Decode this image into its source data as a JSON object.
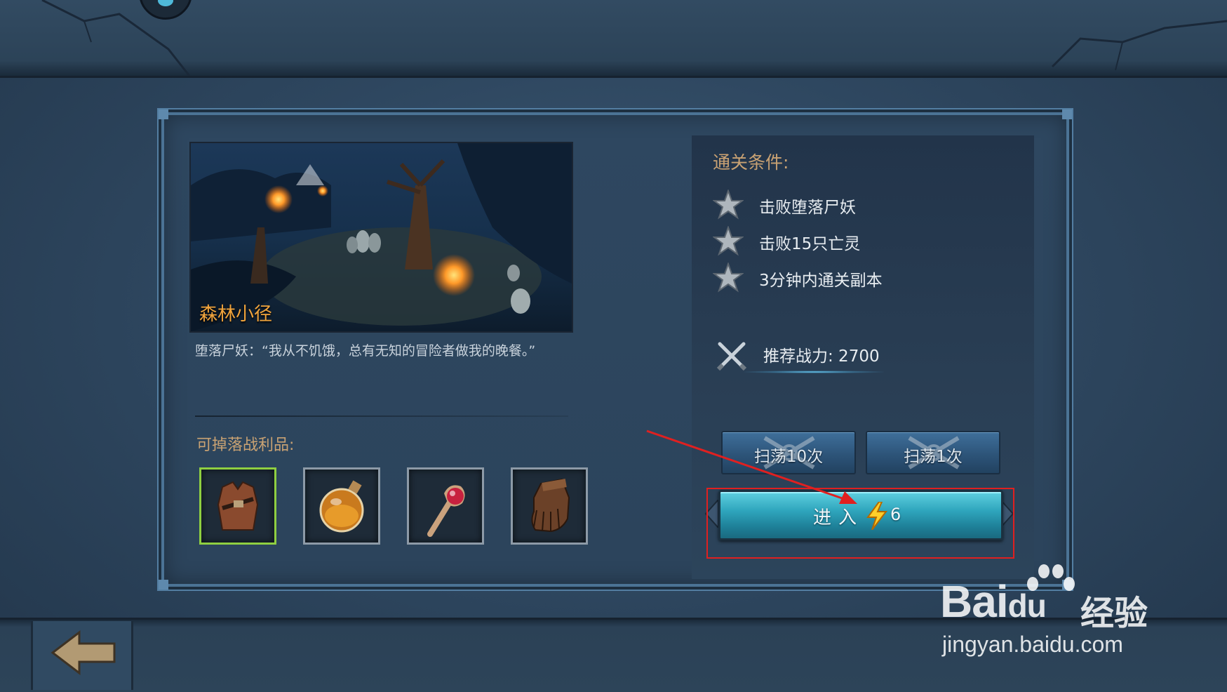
{
  "stage": {
    "name": "森林小径",
    "quote": "堕落尸妖：“我从不饥饿，总有无知的冒险者做我的晚餐。”"
  },
  "loot": {
    "label": "可掉落战利品:",
    "items": [
      {
        "icon": "leather-armor-icon",
        "rarity_color": "#8fcf41"
      },
      {
        "icon": "potion-icon",
        "rarity_color": "#8d9aa7"
      },
      {
        "icon": "staff-icon",
        "rarity_color": "#8d9aa7"
      },
      {
        "icon": "glove-icon",
        "rarity_color": "#8d9aa7"
      }
    ]
  },
  "conditions": {
    "title": "通关条件:",
    "items": [
      "击败堕落尸妖",
      "击败15只亡灵",
      "3分钟内通关副本"
    ]
  },
  "power": {
    "label": "推荐战力: 2700"
  },
  "buttons": {
    "sweep10": "扫荡10次",
    "sweep1": "扫荡1次",
    "enter": "进入",
    "enter_cost": "6"
  },
  "watermark": {
    "brand": "Bai",
    "brand2": "du",
    "cn": "经验",
    "url": "jingyan.baidu.com"
  },
  "colors": {
    "accent_gold": "#c9a273",
    "title_orange": "#f1a43c",
    "enter_cyan": "#2fa6bd",
    "highlight_red": "#e02020"
  }
}
